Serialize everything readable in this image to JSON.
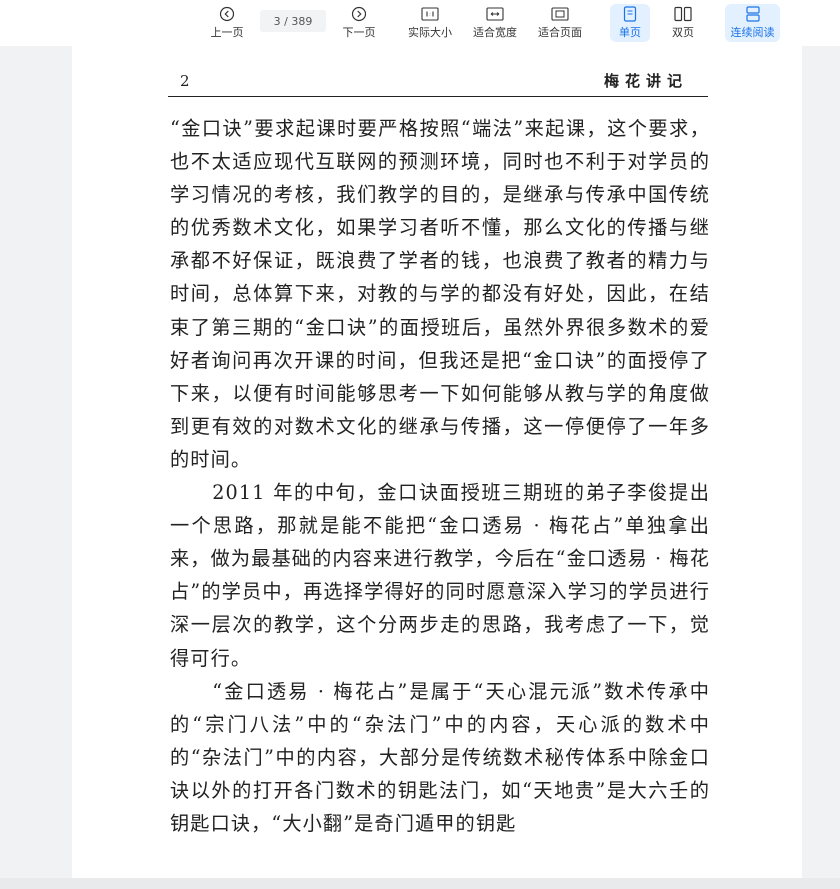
{
  "toolbar": {
    "prev_page": "上一页",
    "page_indicator": "3 / 389",
    "next_page": "下一页",
    "actual_size": "实际大小",
    "fit_width": "适合宽度",
    "fit_page": "适合页面",
    "single_page": "单页",
    "double_page": "双页",
    "continuous_reading": "连续阅读",
    "accent_color": "#1a73e8"
  },
  "page": {
    "number": "2",
    "book_title": "梅花讲记",
    "paragraphs": [
      "“金口诀”要求起课时要严格按照“端法”来起课，这个要求，也不太适应现代互联网的预测环境，同时也不利于对学员的学习情况的考核，我们教学的目的，是继承与传承中国传统的优秀数术文化，如果学习者听不懂，那么文化的传播与继承都不好保证，既浪费了学者的钱，也浪费了教者的精力与时间，总体算下来，对教的与学的都没有好处，因此，在结束了第三期的“金口诀”的面授班后，虽然外界很多数术的爱好者询问再次开课的时间，但我还是把“金口诀”的面授停了下来，以便有时间能够思考一下如何能够从教与学的角度做到更有效的对数术文化的继承与传播，这一停便停了一年多的时间。",
      "2011 年的中旬，金口诀面授班三期班的弟子李俊提出一个思路，那就是能不能把“金口透易 · 梅花占”单独拿出来，做为最基础的内容来进行教学，今后在“金口透易 · 梅花占”的学员中，再选择学得好的同时愿意深入学习的学员进行深一层次的教学，这个分两步走的思路，我考虑了一下，觉得可行。",
      "“金口透易 · 梅花占”是属于“天心混元派”数术传承中的“宗门八法”中的“杂法门”中的内容，天心派的数术中的“杂法门”中的内容，大部分是传统数术秘传体系中除金口诀以外的打开各门数术的钥匙法门，如“天地贵”是大六壬的钥匙口诀，“大小翻”是奇门遁甲的钥匙"
    ]
  }
}
